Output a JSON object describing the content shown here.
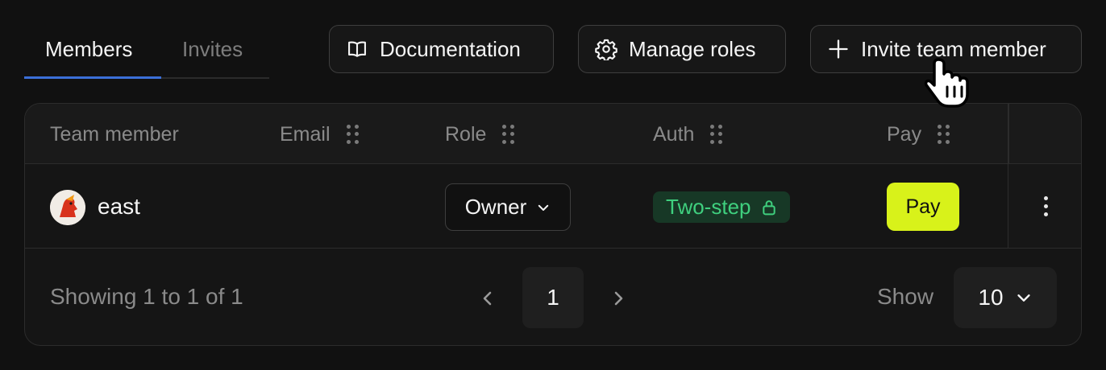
{
  "tabs": [
    {
      "label": "Members",
      "active": true
    },
    {
      "label": "Invites",
      "active": false
    }
  ],
  "toolbar": {
    "documentation_label": "Documentation",
    "manage_roles_label": "Manage roles",
    "invite_label": "Invite team member"
  },
  "table": {
    "columns": [
      "Team member",
      "Email",
      "Role",
      "Auth",
      "Pay"
    ],
    "rows": [
      {
        "member": "east",
        "email": "",
        "role": "Owner",
        "auth": "Two-step",
        "pay_label": "Pay"
      }
    ]
  },
  "footer": {
    "showing_text": "Showing 1 to 1 of 1",
    "current_page": "1",
    "show_label": "Show",
    "per_page": "10"
  },
  "colors": {
    "accent_tab": "#3b6fd8",
    "badge_green": "#3fcf7e",
    "pay_yellow": "#d8f21a"
  },
  "icons": [
    "book-icon",
    "gear-icon",
    "plus-icon",
    "pointer-cursor-icon",
    "drag-handle-icon",
    "chevron-down-icon",
    "lock-icon",
    "more-vertical-icon",
    "chevron-left-icon",
    "chevron-right-icon"
  ]
}
